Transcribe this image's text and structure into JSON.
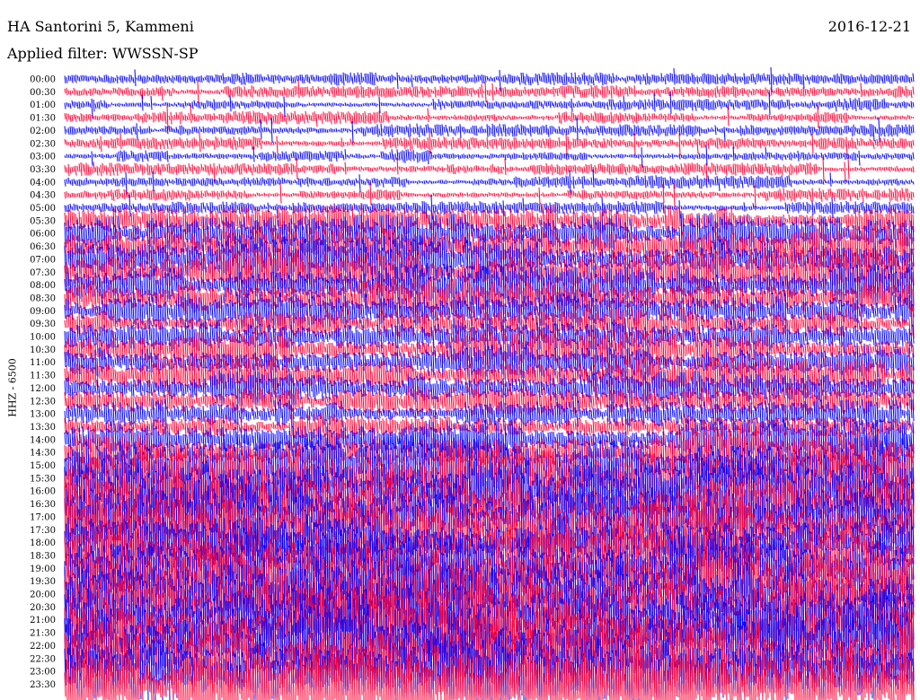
{
  "header": {
    "title": "HA Santorini 5, Kammeni",
    "date": "2016-12-21",
    "filter": "Applied filter: WWSSN-SP"
  },
  "chart_data": {
    "type": "line",
    "title": "HA Santorini 5, Kammeni",
    "ylabel": "HHZ - 6500",
    "y_tick_labels": [
      "00:00",
      "00:30",
      "01:00",
      "01:30",
      "02:00",
      "02:30",
      "03:00",
      "03:30",
      "04:00",
      "04:30",
      "05:00",
      "05:30",
      "06:00",
      "06:30",
      "07:00",
      "07:30",
      "08:00",
      "08:30",
      "09:00",
      "09:30",
      "10:00",
      "10:30",
      "11:00",
      "11:30",
      "12:00",
      "12:30",
      "13:00",
      "13:30",
      "14:00",
      "14:30",
      "15:00",
      "15:30",
      "16:00",
      "16:30",
      "17:00",
      "17:30",
      "18:00",
      "18:30",
      "19:00",
      "19:30",
      "20:00",
      "20:30",
      "21:00",
      "21:30",
      "22:00",
      "22:30",
      "23:00",
      "23:30"
    ],
    "series": [
      {
        "values": [
          5,
          5,
          5,
          5,
          5,
          5,
          5,
          5,
          5,
          5,
          5,
          13,
          16,
          18,
          19,
          18,
          16,
          15,
          14,
          13,
          14,
          15,
          14,
          14,
          13,
          12,
          12,
          10,
          16,
          20,
          24,
          28,
          30,
          28,
          32,
          33,
          28,
          26,
          30,
          32,
          34,
          34,
          36,
          36,
          36,
          34,
          32,
          32
        ]
      }
    ],
    "trace_colors": [
      "#0000ff",
      "#ff0033"
    ],
    "grid": false
  }
}
